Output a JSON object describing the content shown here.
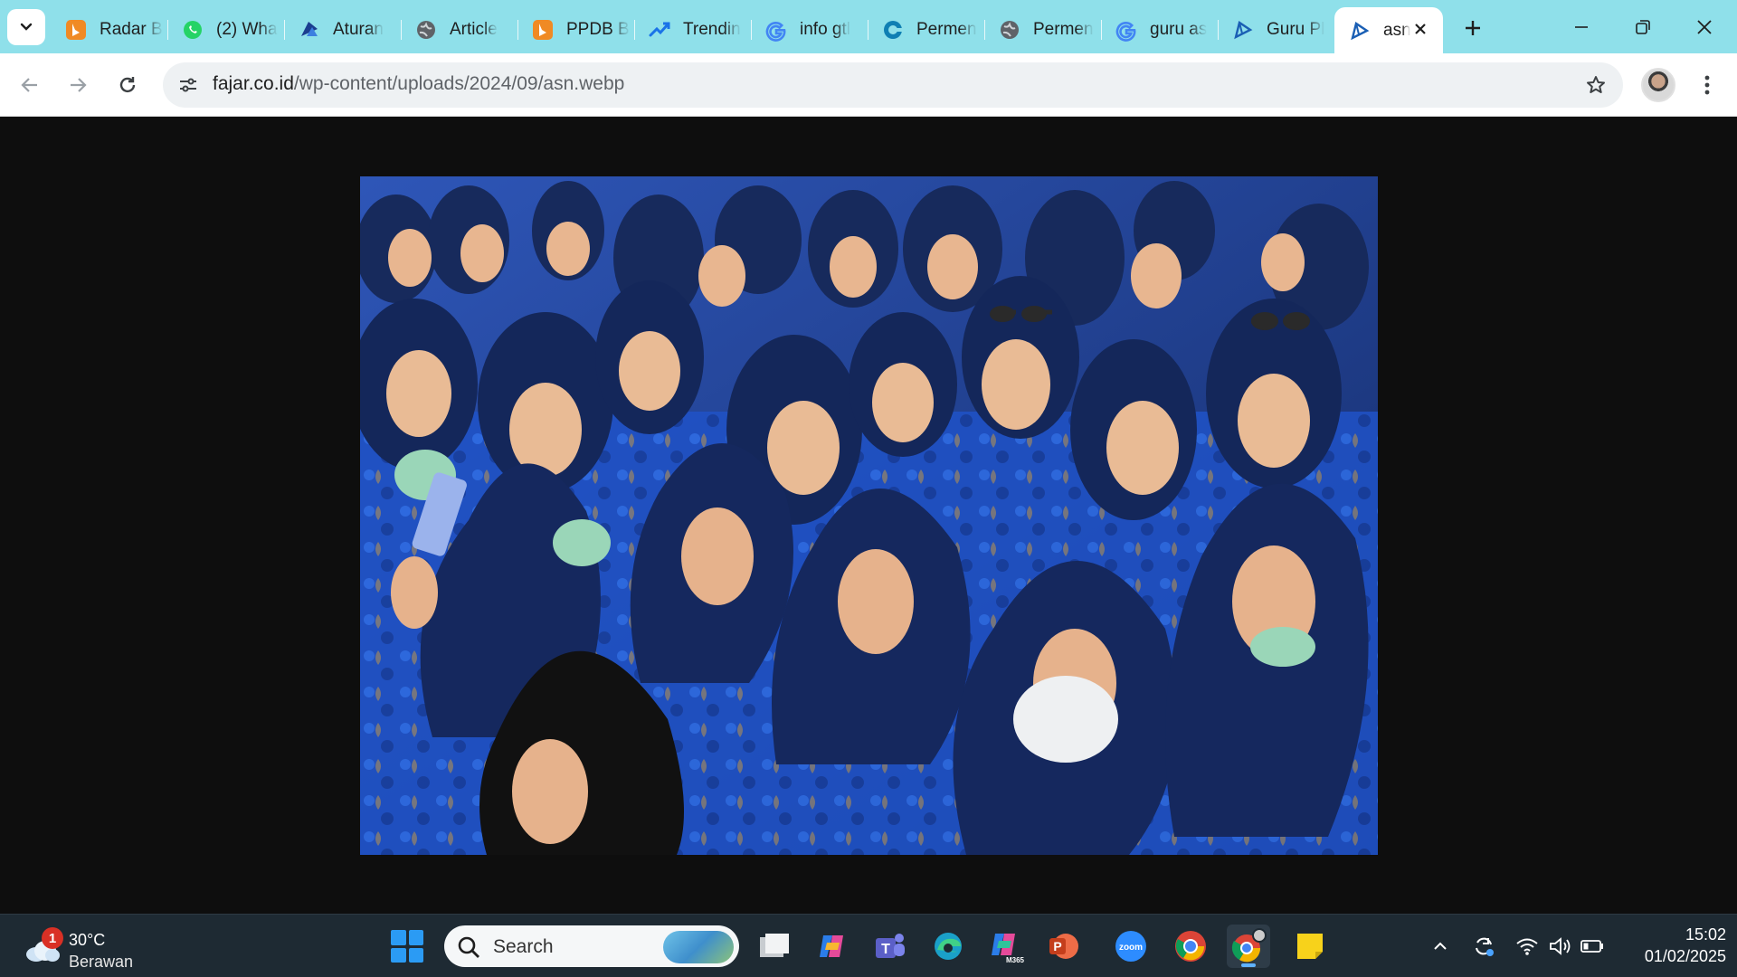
{
  "browser": {
    "tabs": [
      {
        "title": "Radar B",
        "icon": "bing-icon"
      },
      {
        "title": "(2) Wha",
        "icon": "whatsapp-icon"
      },
      {
        "title": "Aturan",
        "icon": "site-logo-icon"
      },
      {
        "title": "Article",
        "icon": "globe-icon"
      },
      {
        "title": "PPDB B",
        "icon": "bing-icon"
      },
      {
        "title": "Trendin",
        "icon": "trend-icon"
      },
      {
        "title": "info gtl",
        "icon": "google-icon"
      },
      {
        "title": "Permen",
        "icon": "copilot-icon"
      },
      {
        "title": "Permen",
        "icon": "globe-icon"
      },
      {
        "title": "guru as",
        "icon": "google-icon"
      },
      {
        "title": "Guru Pl",
        "icon": "image-viewer-icon"
      },
      {
        "title": "asn",
        "icon": "image-viewer-icon",
        "active": true
      }
    ],
    "url_host": "fajar.co.id",
    "url_path": "/wp-content/uploads/2024/09/asn.webp"
  },
  "content": {
    "image_file": "asn.webp"
  },
  "taskbar": {
    "weather_badge": "1",
    "temperature": "30°C",
    "condition": "Berawan",
    "search_placeholder": "Search",
    "apps": [
      "file-manager-icon",
      "copilot-icon",
      "teams-icon",
      "edge-icon",
      "m365-icon",
      "powerpoint-icon",
      "zoom-icon",
      "chrome-icon",
      "chrome-profile-icon",
      "sticky-notes-icon"
    ],
    "zoom_label": "zoom",
    "powerpoint_label": "P",
    "m365_label": "M365",
    "time": "15:02",
    "date": "01/02/2025"
  },
  "colors": {
    "tabstrip": "#8fe0ea",
    "accent": "#2b9bf4",
    "taskbar": "#1e2a33"
  }
}
